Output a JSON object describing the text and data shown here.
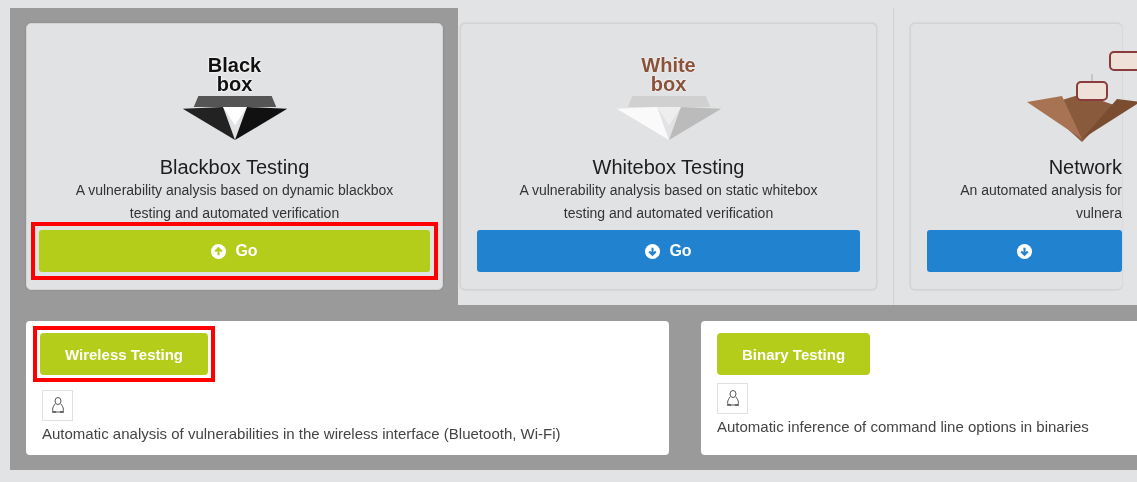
{
  "top_cards": [
    {
      "kind": "black",
      "logo_lines": [
        "Black",
        "box"
      ],
      "title": "Blackbox Testing",
      "description": [
        "A vulnerability analysis based on dynamic blackbox",
        "testing and automated verification"
      ],
      "button": {
        "label": "Go",
        "expanded": true,
        "highlighted": true
      },
      "emphasized": true,
      "cut_off": false
    },
    {
      "kind": "white",
      "logo_lines": [
        "White",
        "box"
      ],
      "title": "Whitebox Testing",
      "description": [
        "A vulnerability analysis based on static whitebox",
        "testing and automated verification"
      ],
      "button": {
        "label": "Go",
        "expanded": false,
        "highlighted": false
      },
      "emphasized": false,
      "cut_off": false
    },
    {
      "kind": "network",
      "title": "Network",
      "description": [
        "An automated analysis for",
        "vulnera"
      ],
      "button": {
        "expanded": false,
        "highlighted": false
      },
      "emphasized": false,
      "cut_off": true
    }
  ],
  "bottom_cards": [
    {
      "button": {
        "label": "Wireless Testing",
        "highlighted": true
      },
      "description": "Automatic analysis of vulnerabilities in the wireless interface (Bluetooth, Wi-Fi)"
    },
    {
      "button": {
        "label": "Binary Testing",
        "highlighted": false
      },
      "description": "Automatic inference of command line options in binaries"
    }
  ]
}
